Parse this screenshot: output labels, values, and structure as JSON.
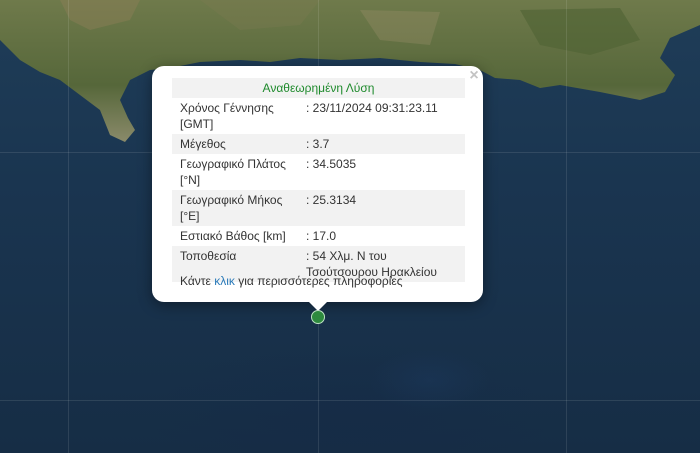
{
  "popup": {
    "title": "Αναθεωρημένη Λύση",
    "rows": [
      {
        "label": "Χρόνος Γέννησης [GMT]",
        "value": ": 23/11/2024 09:31:23.11"
      },
      {
        "label": "Μέγεθος",
        "value": ": 3.7"
      },
      {
        "label": "Γεωγραφικό Πλάτος [°N]",
        "value": ": 34.5035"
      },
      {
        "label": "Γεωγραφικό Μήκος [°E]",
        "value": ": 25.3134"
      },
      {
        "label": "Εστιακό Βάθος [km]",
        "value": ": 17.0"
      },
      {
        "label": "Τοποθεσία",
        "value": ": 54 Χλμ. Ν του Τσούτσουρου Ηρακλείου"
      }
    ],
    "footer_prefix": "Κάντε",
    "footer_link": "κλικ",
    "footer_suffix": "για περισσότερες πληροφορίες",
    "close_label": "×"
  },
  "colors": {
    "sea": "#1a3550",
    "land": "#5a6e3a",
    "marker": "#2d8a3e",
    "title": "#1e8a2c",
    "link": "#2a7ab9"
  },
  "icons": {
    "close": "close-icon",
    "marker": "map-marker-icon"
  }
}
